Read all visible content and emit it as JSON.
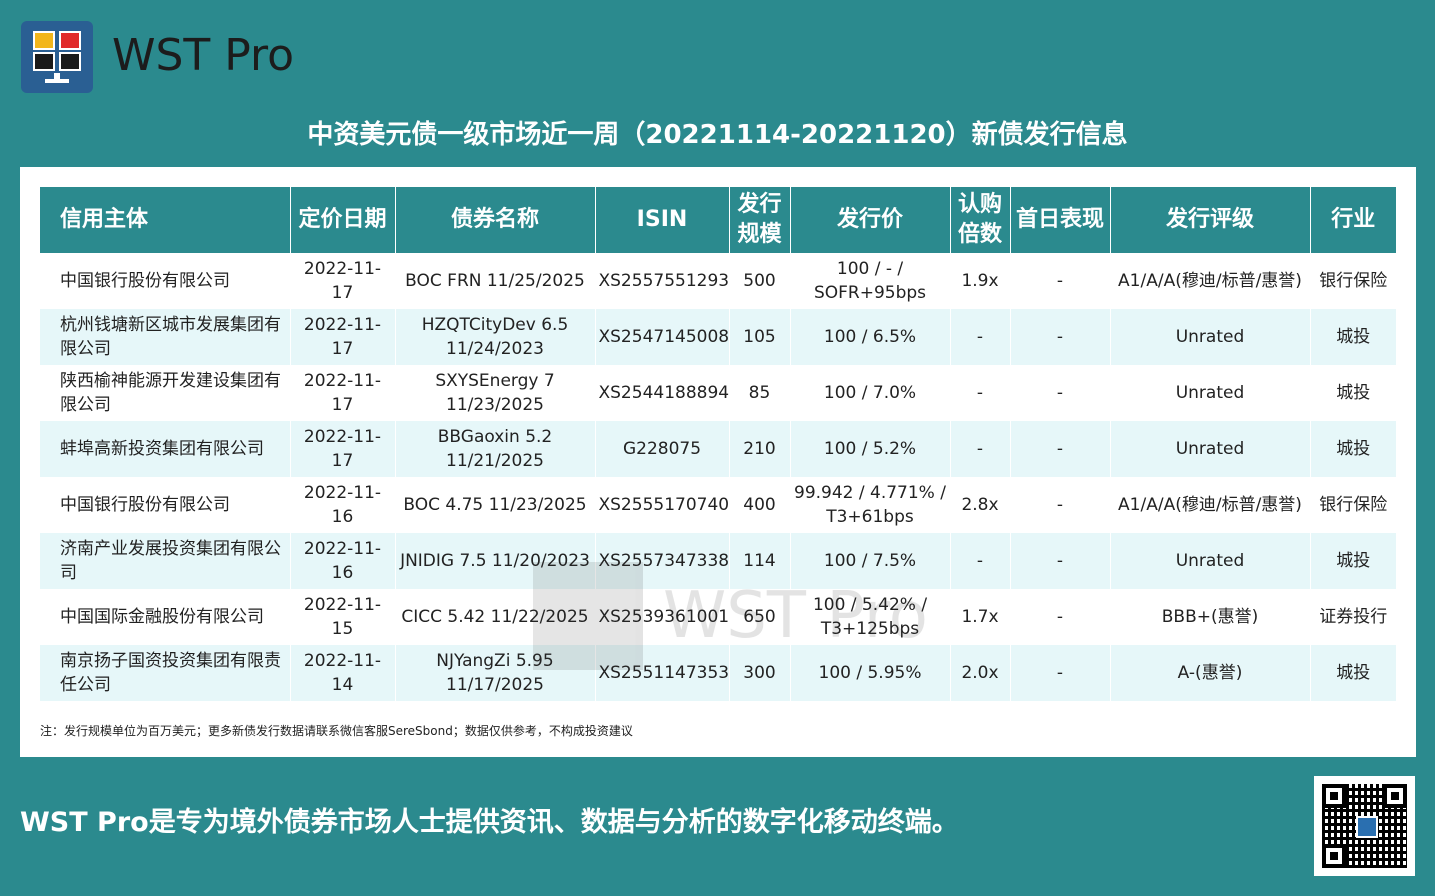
{
  "header": {
    "brand": "WST Pro",
    "logo_icon": "monitor-logo-icon"
  },
  "title": "中资美元债一级市场近一周（20221114-20221120）新债发行信息",
  "table": {
    "columns": [
      "信用主体",
      "定价日期",
      "债券名称",
      "ISIN",
      "发行规模",
      "发行价",
      "认购倍数",
      "首日表现",
      "发行评级",
      "行业"
    ],
    "rows": [
      [
        "中国银行股份有限公司",
        "2022-11-17",
        "BOC FRN 11/25/2025",
        "XS2557551293",
        "500",
        "100 / - / SOFR+95bps",
        "1.9x",
        "-",
        "A1/A/A(穆迪/标普/惠誉)",
        "银行保险"
      ],
      [
        "杭州钱塘新区城市发展集团有限公司",
        "2022-11-17",
        "HZQTCityDev 6.5 11/24/2023",
        "XS2547145008",
        "105",
        "100 / 6.5%",
        "-",
        "-",
        "Unrated",
        "城投"
      ],
      [
        "陕西榆神能源开发建设集团有限公司",
        "2022-11-17",
        "SXYSEnergy 7 11/23/2025",
        "XS2544188894",
        "85",
        "100 / 7.0%",
        "-",
        "-",
        "Unrated",
        "城投"
      ],
      [
        "蚌埠高新投资集团有限公司",
        "2022-11-17",
        "BBGaoxin 5.2 11/21/2025",
        "G228075",
        "210",
        "100 / 5.2%",
        "-",
        "-",
        "Unrated",
        "城投"
      ],
      [
        "中国银行股份有限公司",
        "2022-11-16",
        "BOC 4.75 11/23/2025",
        "XS2555170740",
        "400",
        "99.942 / 4.771% / T3+61bps",
        "2.8x",
        "-",
        "A1/A/A(穆迪/标普/惠誉)",
        "银行保险"
      ],
      [
        "济南产业发展投资集团有限公司",
        "2022-11-16",
        "JNIDIG 7.5 11/20/2023",
        "XS2557347338",
        "114",
        "100 / 7.5%",
        "-",
        "-",
        "Unrated",
        "城投"
      ],
      [
        "中国国际金融股份有限公司",
        "2022-11-15",
        "CICC 5.42 11/22/2025",
        "XS2539361001",
        "650",
        "100 / 5.42% / T3+125bps",
        "1.7x",
        "-",
        "BBB+(惠誉)",
        "证券投行"
      ],
      [
        "南京扬子国资投资集团有限责任公司",
        "2022-11-14",
        "NJYangZi 5.95 11/17/2025",
        "XS2551147353",
        "300",
        "100 / 5.95%",
        "2.0x",
        "-",
        "A-(惠誉)",
        "城投"
      ]
    ]
  },
  "watermark": "WST Pro",
  "note": "注：发行规模单位为百万美元；更多新债发行数据请联系微信客服SereSbond；数据仅供参考，不构成投资建议",
  "footer": "WST Pro是专为境外债券市场人士提供资讯、数据与分析的数字化移动终端。",
  "qr_icon": "qr-code-icon"
}
